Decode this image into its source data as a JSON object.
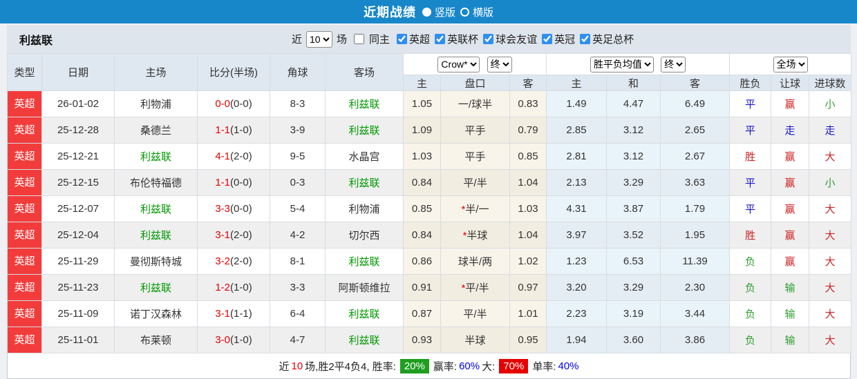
{
  "title_bar": {
    "title": "近期战绩",
    "layout_options": [
      {
        "label": "竖版",
        "selected": true
      },
      {
        "label": "横版",
        "selected": false
      }
    ]
  },
  "filter_bar": {
    "team_name": "利兹联",
    "recent_label": "近",
    "recent_value": "10",
    "matches_label": "场",
    "same_home": {
      "label": "同主",
      "checked": false
    },
    "competitions": [
      {
        "label": "英超",
        "checked": true
      },
      {
        "label": "英联杯",
        "checked": true
      },
      {
        "label": "球会友谊",
        "checked": true
      },
      {
        "label": "英冠",
        "checked": true
      },
      {
        "label": "英足总杯",
        "checked": true
      }
    ]
  },
  "table": {
    "static_headers": [
      "类型",
      "日期",
      "主场",
      "比分(半场)",
      "角球",
      "客场"
    ],
    "group_headers": {
      "odds_source": "Crow*",
      "odds_time": "终",
      "avg_label": "胜平负均值",
      "avg_time": "终",
      "scope": "全场"
    },
    "sub_headers": [
      "主",
      "盘口",
      "客",
      "主",
      "和",
      "客",
      "胜负",
      "让球",
      "进球数"
    ],
    "rows": [
      {
        "type": "英超",
        "date": "26-01-02",
        "home": "利物浦",
        "home_is_self": false,
        "score_ft": "0-0",
        "score_ht": "0-0",
        "corner": "8-3",
        "away": "利兹联",
        "away_is_self": true,
        "crow_home": "1.05",
        "hc_star": "",
        "handicap": "一/球半",
        "crow_away": "0.83",
        "avg_home": "1.49",
        "avg_draw": "4.47",
        "avg_away": "6.49",
        "result": "平",
        "handicap_result": "赢",
        "goals_result": "小"
      },
      {
        "type": "英超",
        "date": "25-12-28",
        "home": "桑德兰",
        "home_is_self": false,
        "score_ft": "1-1",
        "score_ht": "1-0",
        "corner": "3-9",
        "away": "利兹联",
        "away_is_self": true,
        "crow_home": "1.09",
        "hc_star": "",
        "handicap": "平手",
        "crow_away": "0.79",
        "avg_home": "2.85",
        "avg_draw": "3.12",
        "avg_away": "2.65",
        "result": "平",
        "handicap_result": "走",
        "goals_result": "走"
      },
      {
        "type": "英超",
        "date": "25-12-21",
        "home": "利兹联",
        "home_is_self": true,
        "score_ft": "4-1",
        "score_ht": "2-0",
        "corner": "9-5",
        "away": "水晶宫",
        "away_is_self": false,
        "crow_home": "1.03",
        "hc_star": "",
        "handicap": "平手",
        "crow_away": "0.85",
        "avg_home": "2.81",
        "avg_draw": "3.12",
        "avg_away": "2.67",
        "result": "胜",
        "handicap_result": "赢",
        "goals_result": "大"
      },
      {
        "type": "英超",
        "date": "25-12-15",
        "home": "布伦特福德",
        "home_is_self": false,
        "score_ft": "1-1",
        "score_ht": "0-0",
        "corner": "0-3",
        "away": "利兹联",
        "away_is_self": true,
        "crow_home": "0.84",
        "hc_star": "",
        "handicap": "平/半",
        "crow_away": "1.04",
        "avg_home": "2.13",
        "avg_draw": "3.29",
        "avg_away": "3.63",
        "result": "平",
        "handicap_result": "赢",
        "goals_result": "小"
      },
      {
        "type": "英超",
        "date": "25-12-07",
        "home": "利兹联",
        "home_is_self": true,
        "score_ft": "3-3",
        "score_ht": "0-0",
        "corner": "5-4",
        "away": "利物浦",
        "away_is_self": false,
        "crow_home": "0.85",
        "hc_star": "*",
        "handicap": "半/一",
        "crow_away": "1.03",
        "avg_home": "4.31",
        "avg_draw": "3.87",
        "avg_away": "1.79",
        "result": "平",
        "handicap_result": "赢",
        "goals_result": "大"
      },
      {
        "type": "英超",
        "date": "25-12-04",
        "home": "利兹联",
        "home_is_self": true,
        "score_ft": "3-1",
        "score_ht": "2-0",
        "corner": "4-2",
        "away": "切尔西",
        "away_is_self": false,
        "crow_home": "0.84",
        "hc_star": "*",
        "handicap": "半球",
        "crow_away": "1.04",
        "avg_home": "3.97",
        "avg_draw": "3.52",
        "avg_away": "1.95",
        "result": "胜",
        "handicap_result": "赢",
        "goals_result": "大"
      },
      {
        "type": "英超",
        "date": "25-11-29",
        "home": "曼彻斯特城",
        "home_is_self": false,
        "score_ft": "3-2",
        "score_ht": "2-0",
        "corner": "8-1",
        "away": "利兹联",
        "away_is_self": true,
        "crow_home": "0.86",
        "hc_star": "",
        "handicap": "球半/两",
        "crow_away": "1.02",
        "avg_home": "1.23",
        "avg_draw": "6.53",
        "avg_away": "11.39",
        "result": "负",
        "handicap_result": "赢",
        "goals_result": "大"
      },
      {
        "type": "英超",
        "date": "25-11-23",
        "home": "利兹联",
        "home_is_self": true,
        "score_ft": "1-2",
        "score_ht": "1-0",
        "corner": "3-3",
        "away": "阿斯顿维拉",
        "away_is_self": false,
        "crow_home": "0.91",
        "hc_star": "*",
        "handicap": "平/半",
        "crow_away": "0.97",
        "avg_home": "3.20",
        "avg_draw": "3.29",
        "avg_away": "2.30",
        "result": "负",
        "handicap_result": "输",
        "goals_result": "大"
      },
      {
        "type": "英超",
        "date": "25-11-09",
        "home": "诺丁汉森林",
        "home_is_self": false,
        "score_ft": "3-1",
        "score_ht": "1-1",
        "corner": "6-4",
        "away": "利兹联",
        "away_is_self": true,
        "crow_home": "0.87",
        "hc_star": "",
        "handicap": "平/半",
        "crow_away": "1.01",
        "avg_home": "2.23",
        "avg_draw": "3.19",
        "avg_away": "3.44",
        "result": "负",
        "handicap_result": "输",
        "goals_result": "大"
      },
      {
        "type": "英超",
        "date": "25-11-01",
        "home": "布莱顿",
        "home_is_self": false,
        "score_ft": "3-0",
        "score_ht": "1-0",
        "corner": "4-7",
        "away": "利兹联",
        "away_is_self": true,
        "crow_home": "0.93",
        "hc_star": "",
        "handicap": "半球",
        "crow_away": "0.95",
        "avg_home": "1.94",
        "avg_draw": "3.60",
        "avg_away": "3.86",
        "result": "负",
        "handicap_result": "输",
        "goals_result": "大"
      }
    ]
  },
  "footer": {
    "prefix": "近",
    "recent_count": "10",
    "summary": "场,胜2平4负4, 胜率:",
    "win_rate": "20%",
    "win_label": "赢率:",
    "win_pct": "60%",
    "big_label": "大:",
    "big_rate": "70%",
    "single_label": "单率:",
    "single_pct": "40%"
  },
  "colors": {
    "accent_blue": "#1787ca",
    "badge_red": "#f23c3c",
    "score_red": "#e60000",
    "self_team_green": "#009900",
    "win_red": "#cc2222",
    "draw_blue": "#1515cc",
    "lose_green": "#2e9e2e",
    "rate_green_bg": "#1f9e1f",
    "rate_red_bg": "#e60000",
    "pct_blue": "#0000ee"
  }
}
